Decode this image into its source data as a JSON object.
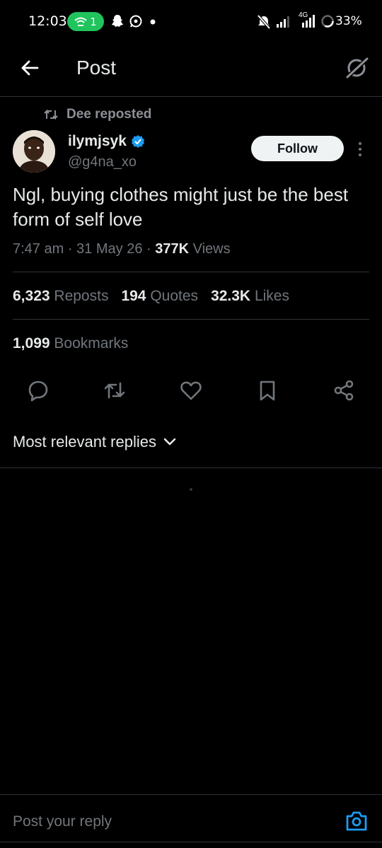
{
  "status_bar": {
    "time": "12:03",
    "hotspot_count": "1",
    "battery": "33%",
    "network": "4G"
  },
  "header": {
    "title": "Post"
  },
  "repost": {
    "label": "Dee reposted"
  },
  "author": {
    "name": "ilymjsyk",
    "handle": "@g4na_xo",
    "verified": true
  },
  "follow_label": "Follow",
  "tweet": {
    "text": "Ngl, buying clothes might just be the best form of self love",
    "time": "7:47 am",
    "date": "31 May 26",
    "views_count": "377K",
    "views_label": "Views"
  },
  "stats": {
    "reposts_count": "6,323",
    "reposts_label": "Reposts",
    "quotes_count": "194",
    "quotes_label": "Quotes",
    "likes_count": "32.3K",
    "likes_label": "Likes",
    "bookmarks_count": "1,099",
    "bookmarks_label": "Bookmarks"
  },
  "actions": [
    "reply-icon",
    "repost-icon",
    "like-icon",
    "bookmark-icon",
    "share-icon"
  ],
  "replies": {
    "sort_label": "Most relevant replies"
  },
  "reply_box": {
    "placeholder": "Post your reply"
  },
  "colors": {
    "background": "#000000",
    "text": "#e7e9ea",
    "muted": "#71767b",
    "accent": "#1d9bf0",
    "hotspot": "#20c35c"
  }
}
